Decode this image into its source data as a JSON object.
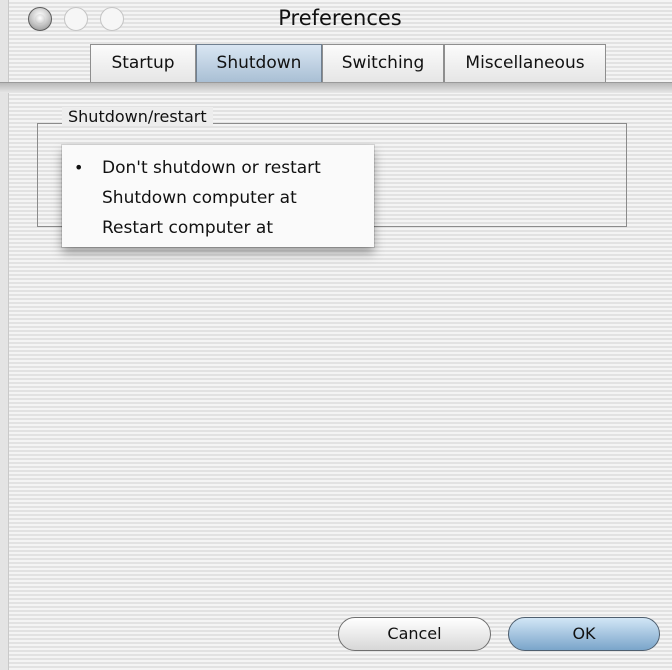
{
  "window": {
    "title": "Preferences"
  },
  "tabs": [
    {
      "label": "Startup",
      "selected": false
    },
    {
      "label": "Shutdown",
      "selected": true
    },
    {
      "label": "Switching",
      "selected": false
    },
    {
      "label": "Miscellaneous",
      "selected": false
    }
  ],
  "group": {
    "label": "Shutdown/restart"
  },
  "menu": {
    "selected_marker": "•",
    "items": [
      {
        "label": "Don't shutdown or restart",
        "selected": true
      },
      {
        "label": "Shutdown computer at",
        "selected": false
      },
      {
        "label": "Restart computer at",
        "selected": false
      }
    ]
  },
  "buttons": {
    "cancel": "Cancel",
    "ok": "OK"
  },
  "icons": {
    "close": "close-button-icon",
    "minimize": "minimize-button-icon",
    "zoom": "zoom-button-icon"
  },
  "colors": {
    "selected_tab": "#a9bfd4",
    "default_button": "#7aa5ca"
  }
}
